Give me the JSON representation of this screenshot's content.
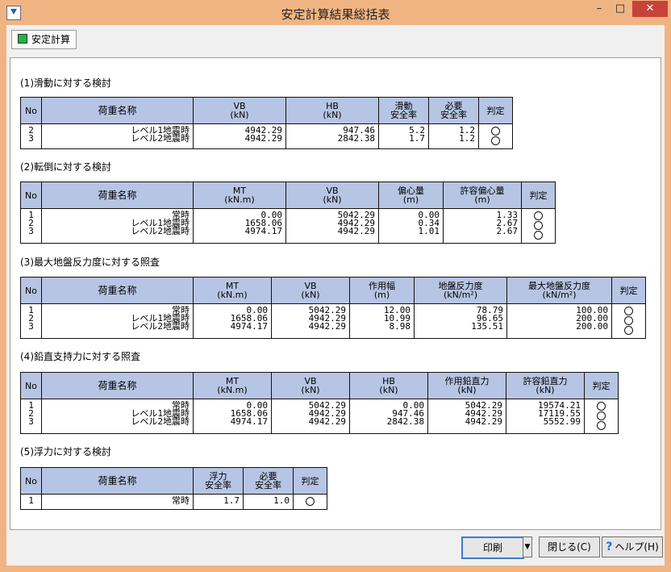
{
  "window": {
    "title": "安定計算結果総括表",
    "min": "–",
    "max": "□",
    "close": "✕"
  },
  "tab": {
    "label": "安定計算"
  },
  "sec1": {
    "title": "(1)滑動に対する検討",
    "headers": [
      "No",
      "荷重名称",
      "VB\n(kN)",
      "HB\n(kN)",
      "滑動\n安全率",
      "必要\n安全率",
      "判定"
    ],
    "no": "2\n3",
    "name": "レベル1地震時\nレベル2地震時",
    "c1": "4942.29\n4942.29",
    "c2": "947.46\n2842.38",
    "c3": "5.2\n1.7",
    "c4": "1.2\n1.2"
  },
  "sec2": {
    "title": "(2)転倒に対する検討",
    "headers": [
      "No",
      "荷重名称",
      "MT\n(kN.m)",
      "VB\n(kN)",
      "偏心量\n(m)",
      "許容偏心量\n(m)",
      "判定"
    ],
    "no": "1\n2\n3",
    "name": "常時\nレベル1地震時\nレベル2地震時",
    "c1": "0.00\n1658.06\n4974.17",
    "c2": "5042.29\n4942.29\n4942.29",
    "c3": "0.00\n0.34\n1.01",
    "c4": "1.33\n2.67\n2.67"
  },
  "sec3": {
    "title": "(3)最大地盤反力度に対する照査",
    "headers": [
      "No",
      "荷重名称",
      "MT\n(kN.m)",
      "VB\n(kN)",
      "作用幅\n(m)",
      "地盤反力度\n(kN/m²)",
      "最大地盤反力度\n(kN/m²)",
      "判定"
    ],
    "no": "1\n2\n3",
    "name": "常時\nレベル1地震時\nレベル2地震時",
    "c1": "0.00\n1658.06\n4974.17",
    "c2": "5042.29\n4942.29\n4942.29",
    "c3": "12.00\n10.99\n8.98",
    "c4": "78.79\n96.65\n135.51",
    "c5": "100.00\n200.00\n200.00"
  },
  "sec4": {
    "title": "(4)鉛直支持力に対する照査",
    "headers": [
      "No",
      "荷重名称",
      "MT\n(kN.m)",
      "VB\n(kN)",
      "HB\n(kN)",
      "作用鉛直力\n(kN)",
      "許容鉛直力\n(kN)",
      "判定"
    ],
    "no": "1\n2\n3",
    "name": "常時\nレベル1地震時\nレベル2地震時",
    "c1": "0.00\n1658.06\n4974.17",
    "c2": "5042.29\n4942.29\n4942.29",
    "c3": "0.00\n947.46\n2842.38",
    "c4": "5042.29\n4942.29\n4942.29",
    "c5": "19574.21\n17119.55\n5552.99"
  },
  "sec5": {
    "title": "(5)浮力に対する検討",
    "headers": [
      "No",
      "荷重名称",
      "浮力\n安全率",
      "必要\n安全率",
      "判定"
    ],
    "no": "1",
    "name": "常時",
    "c1": "1.7",
    "c2": "1.0"
  },
  "buttons": {
    "print": "印刷",
    "close": "閉じる(C)",
    "help": "ヘルプ(H)"
  }
}
